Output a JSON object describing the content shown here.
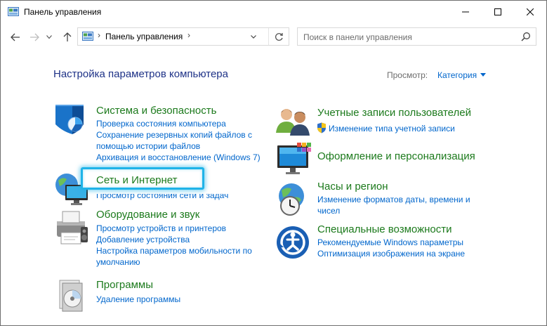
{
  "window": {
    "title": "Панель управления"
  },
  "address": {
    "path": "Панель управления",
    "separator": "›"
  },
  "search": {
    "placeholder": "Поиск в панели управления"
  },
  "main": {
    "title": "Настройка параметров компьютера",
    "view_label": "Просмотр:",
    "view_value": "Категория"
  },
  "categories_left": [
    {
      "title": "Система и безопасность",
      "icon": "shield-icon",
      "links": [
        "Проверка состояния компьютера",
        "Сохранение резервных копий файлов с",
        "помощью истории файлов",
        "Архивация и восстановление (Windows 7)"
      ]
    },
    {
      "title": "Сеть и Интернет",
      "icon": "network-globe-icon",
      "links": [
        "Просмотр состояния сети и задач"
      ]
    },
    {
      "title": "Оборудование и звук",
      "icon": "printer-icon",
      "links": [
        "Просмотр устройств и принтеров",
        "Добавление устройства",
        "Настройка параметров мобильности по",
        "умолчанию"
      ]
    },
    {
      "title": "Программы",
      "icon": "programs-disc-icon",
      "links": [
        "Удаление программы"
      ]
    }
  ],
  "categories_right": [
    {
      "title": "Учетные записи пользователей",
      "icon": "users-icon",
      "links": [
        "Изменение типа учетной записи"
      ]
    },
    {
      "title": "Оформление и персонализация",
      "icon": "monitor-palette-icon",
      "links": []
    },
    {
      "title": "Часы и регион",
      "icon": "clock-globe-icon",
      "links": [
        "Изменение форматов даты, времени и",
        "чисел"
      ]
    },
    {
      "title": "Специальные возможности",
      "icon": "ease-of-access-icon",
      "links": [
        "Рекомендуемые Windows параметры",
        "Оптимизация изображения на экране"
      ]
    }
  ],
  "colors": {
    "category_title": "#1c7a1c",
    "link": "#0066cc",
    "page_title": "#1e3287",
    "highlight": "#1fb3e8"
  }
}
